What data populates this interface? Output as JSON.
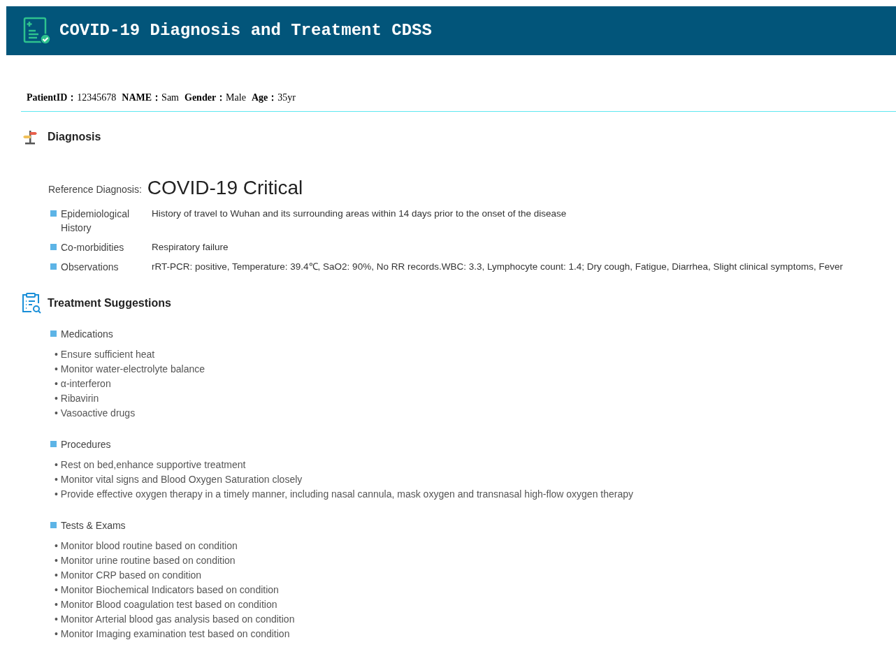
{
  "header": {
    "title": "COVID-19 Diagnosis and Treatment CDSS"
  },
  "patient": [
    {
      "label": "PatientID：",
      "value": "12345678"
    },
    {
      "label": "NAME：",
      "value": "Sam"
    },
    {
      "label": "Gender：",
      "value": "Male"
    },
    {
      "label": "Age：",
      "value": "35yr"
    }
  ],
  "diagnosis": {
    "title": "Diagnosis",
    "reference_label": "Reference Diagnosis:",
    "reference_value": "COVID-19 Critical",
    "rows": [
      {
        "label": "Epidemiological History",
        "value": "History of travel to Wuhan and its surrounding areas within 14 days prior to the onset of the disease"
      },
      {
        "label": "Co-morbidities",
        "value": "Respiratory failure"
      },
      {
        "label": "Observations",
        "value": "rRT-PCR: positive, Temperature: 39.4℃, SaO2: 90%, No RR records.WBC: 3.3, Lymphocyte count: 1.4; Dry cough, Fatigue, Diarrhea, Slight clinical symptoms, Fever"
      }
    ]
  },
  "treatment": {
    "title": "Treatment Suggestions",
    "sections": [
      {
        "title": "Medications",
        "items": [
          "• Ensure sufficient heat",
          "• Monitor water-electrolyte balance",
          "• α-interferon",
          "• Ribavirin",
          "• Vasoactive drugs"
        ]
      },
      {
        "title": "Procedures",
        "items": [
          "• Rest on bed,enhance supportive treatment",
          "• Monitor vital signs and Blood Oxygen Saturation closely",
          "• Provide effective oxygen therapy in a timely manner, including nasal cannula, mask oxygen and transnasal high-flow oxygen therapy"
        ]
      },
      {
        "title": "Tests & Exams",
        "items": [
          "• Monitor blood routine based on condition",
          "• Monitor urine routine based on condition",
          "• Monitor CRP based on condition",
          "• Monitor Biochemical Indicators based on condition",
          "• Monitor Blood coagulation test based on condition",
          "• Monitor Arterial blood gas analysis based on condition",
          "• Monitor Imaging examination test based on condition"
        ]
      }
    ]
  }
}
